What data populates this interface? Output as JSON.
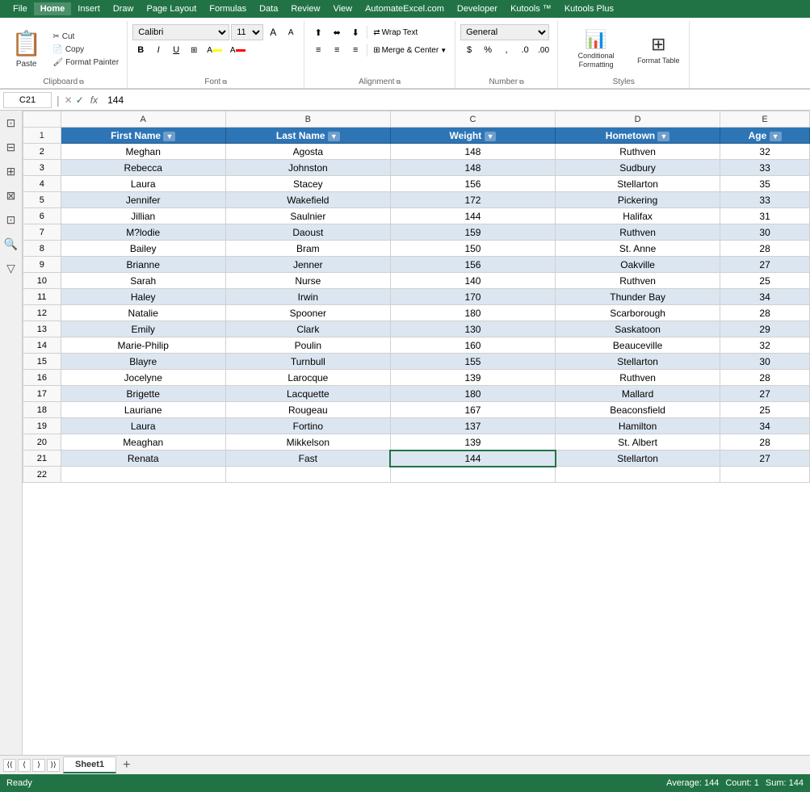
{
  "menu": {
    "items": [
      "File",
      "Home",
      "Insert",
      "Draw",
      "Page Layout",
      "Formulas",
      "Data",
      "Review",
      "View",
      "AutomateExcel.com",
      "Developer",
      "Kutools ™",
      "Kutools Plus"
    ]
  },
  "ribbon": {
    "tabs": [
      "File",
      "Home",
      "Insert",
      "Draw",
      "Page Layout",
      "Formulas",
      "Data",
      "Review",
      "View",
      "AutomateExcel.com",
      "Developer",
      "Kutools ™",
      "Kutools Plus"
    ],
    "active_tab": "Home",
    "groups": {
      "clipboard": {
        "label": "Clipboard",
        "paste": "Paste",
        "cut": "Cut",
        "copy": "Copy",
        "format_painter": "Format Painter"
      },
      "font": {
        "label": "Font",
        "font_name": "Calibri",
        "font_size": "11",
        "bold": "B",
        "italic": "I",
        "underline": "U"
      },
      "alignment": {
        "label": "Alignment",
        "wrap_text": "Wrap Text",
        "merge": "Merge & Center"
      },
      "number": {
        "label": "Number",
        "format": "General"
      },
      "styles": {
        "label": "Styles",
        "conditional": "Conditional Formatting",
        "format_table": "Format Table"
      }
    }
  },
  "formula_bar": {
    "cell_ref": "C21",
    "formula": "144",
    "cancel_btn": "✕",
    "confirm_btn": "✓",
    "fx": "fx"
  },
  "columns": {
    "row_num_width": 40,
    "headers": [
      "",
      "A",
      "B",
      "C",
      "D",
      "E"
    ],
    "col_labels": {
      "A": "First Name",
      "B": "Last Name",
      "C": "Weight",
      "D": "Hometown",
      "E": "Age"
    },
    "widths": [
      40,
      175,
      175,
      175,
      175,
      95
    ]
  },
  "table": {
    "headers": [
      "First Name",
      "Last Name",
      "Weight",
      "Hometown",
      "Age"
    ],
    "rows": [
      [
        "Meghan",
        "Agosta",
        "148",
        "Ruthven",
        "32"
      ],
      [
        "Rebecca",
        "Johnston",
        "148",
        "Sudbury",
        "33"
      ],
      [
        "Laura",
        "Stacey",
        "156",
        "Stellarton",
        "35"
      ],
      [
        "Jennifer",
        "Wakefield",
        "172",
        "Pickering",
        "33"
      ],
      [
        "Jillian",
        "Saulnier",
        "144",
        "Halifax",
        "31"
      ],
      [
        "M?lodie",
        "Daoust",
        "159",
        "Ruthven",
        "30"
      ],
      [
        "Bailey",
        "Bram",
        "150",
        "St. Anne",
        "28"
      ],
      [
        "Brianne",
        "Jenner",
        "156",
        "Oakville",
        "27"
      ],
      [
        "Sarah",
        "Nurse",
        "140",
        "Ruthven",
        "25"
      ],
      [
        "Haley",
        "Irwin",
        "170",
        "Thunder Bay",
        "34"
      ],
      [
        "Natalie",
        "Spooner",
        "180",
        "Scarborough",
        "28"
      ],
      [
        "Emily",
        "Clark",
        "130",
        "Saskatoon",
        "29"
      ],
      [
        "Marie-Philip",
        "Poulin",
        "160",
        "Beauceville",
        "32"
      ],
      [
        "Blayre",
        "Turnbull",
        "155",
        "Stellarton",
        "30"
      ],
      [
        "Jocelyne",
        "Larocque",
        "139",
        "Ruthven",
        "28"
      ],
      [
        "Brigette",
        "Lacquette",
        "180",
        "Mallard",
        "27"
      ],
      [
        "Lauriane",
        "Rougeau",
        "167",
        "Beaconsfield",
        "25"
      ],
      [
        "Laura",
        "Fortino",
        "137",
        "Hamilton",
        "34"
      ],
      [
        "Meaghan",
        "Mikkelson",
        "139",
        "St. Albert",
        "28"
      ],
      [
        "Renata",
        "Fast",
        "144",
        "Stellarton",
        "27"
      ]
    ],
    "selected_cell": {
      "row": 21,
      "col": "C"
    },
    "header_bg": "#2e75b6",
    "alt_row_bg": "#dce6f1"
  },
  "sheet_tabs": {
    "tabs": [
      "Sheet1"
    ],
    "active": "Sheet1"
  },
  "status_bar": {
    "items": [
      "Ready"
    ],
    "right": [
      "Average: 144",
      "Count: 1",
      "Sum: 144"
    ]
  }
}
